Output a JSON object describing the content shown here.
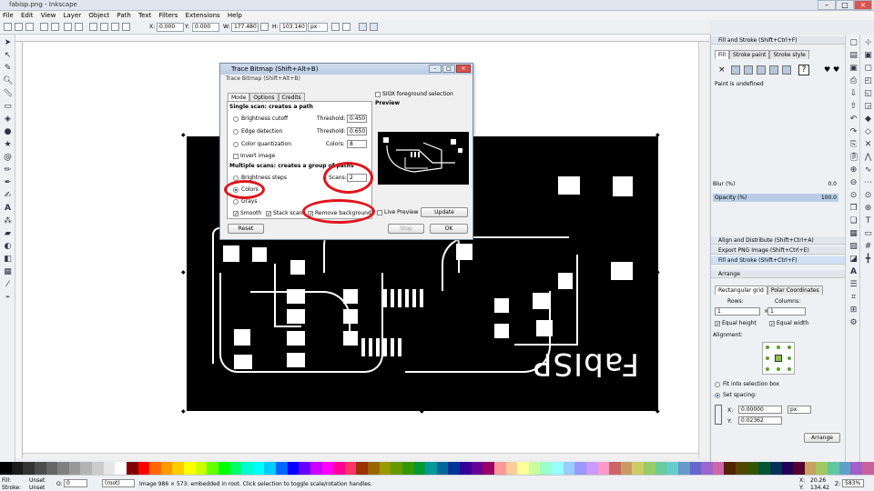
{
  "window": {
    "title": "fabisp.png - Inkscape"
  },
  "menu": [
    "File",
    "Edit",
    "View",
    "Layer",
    "Object",
    "Path",
    "Text",
    "Filters",
    "Extensions",
    "Help"
  ],
  "controls": {
    "x_label": "X:",
    "x": "0.000",
    "y_label": "Y:",
    "y": "0.000",
    "w_label": "W:",
    "w": "177.480",
    "h_label": "H:",
    "h": "103.140",
    "unit": "px"
  },
  "canvas": {
    "pcb_text": "FabISP"
  },
  "dialog": {
    "title": "Trace Bitmap (Shift+Alt+B)",
    "subtitle": "Trace Bitmap (Shift+Alt+B)",
    "tabs": [
      "Mode",
      "Options",
      "Credits"
    ],
    "single_scan": "Single scan: creates a path",
    "brightness_cutoff": "Brightness cutoff",
    "threshold_label": "Threshold:",
    "threshold1": "0.450",
    "edge_detection": "Edge detection",
    "threshold2": "0.650",
    "color_quantization": "Color quantization",
    "colors_label": "Colors:",
    "colors": "8",
    "invert_image": "Invert image",
    "multi_scan": "Multiple scans: creates a group of paths",
    "brightness_steps": "Brightness steps",
    "scans_label": "Scans:",
    "scans": "2",
    "colors_opt": "Colors",
    "grays_opt": "Grays",
    "smooth": "Smooth",
    "stack_scans": "Stack scans",
    "remove_background": "Remove background",
    "siox": "SIOX foreground selection",
    "preview_label": "Preview",
    "live_preview": "Live Preview",
    "update": "Update",
    "reset": "Reset",
    "stop": "Stop",
    "ok": "OK"
  },
  "fill_stroke": {
    "header": "Fill and Stroke (Shift+Ctrl+F)",
    "tabs": [
      "Fill",
      "Stroke paint",
      "Stroke style"
    ],
    "status": "Paint is undefined",
    "blur_label": "Blur (%)",
    "blur": "0.0",
    "opacity_label": "Opacity (%)",
    "opacity": "100.0"
  },
  "docks": [
    "Align and Distribute (Shift+Ctrl+A)",
    "Export PNG Image (Shift+Ctrl+E)",
    "Fill and Stroke (Shift+Ctrl+F)",
    "Arrange"
  ],
  "arrange": {
    "tabs": [
      "Rectangular grid",
      "Polar Coordinates"
    ],
    "rows_label": "Rows:",
    "rows": "1",
    "cols_label": "Columns:",
    "cols": "1",
    "equal_height": "Equal height",
    "equal_width": "Equal width",
    "alignment": "Alignment:",
    "fit_into": "Fit into selection box",
    "set_spacing": "Set spacing:",
    "x_label": "X:",
    "x": "0.00000",
    "y_label": "Y:",
    "y": "0.02362",
    "unit": "px",
    "arrange_btn": "Arrange"
  },
  "status": {
    "fill_label": "Fill:",
    "fill": "Unset",
    "stroke_label": "Stroke:",
    "stroke": "Unset",
    "o_label": "O:",
    "o": "0",
    "layer": "(root)",
    "message": "Image 986 × 573: embedded in root. Click selection to toggle scale/rotation handles.",
    "x_label": "X:",
    "x": "20.26",
    "y_label": "Y:",
    "y": "134.42",
    "z_label": "Z:",
    "zoom": "583%"
  },
  "palette": [
    "#000000",
    "#1a1a1a",
    "#333333",
    "#4d4d4d",
    "#666666",
    "#808080",
    "#999999",
    "#b3b3b3",
    "#cccccc",
    "#e6e6e6",
    "#ffffff",
    "#800000",
    "#ff0000",
    "#ff6600",
    "#ff9900",
    "#ffcc00",
    "#ffff00",
    "#ccff00",
    "#66ff00",
    "#00ff00",
    "#00ff66",
    "#00ffcc",
    "#00ffff",
    "#00ccff",
    "#0066ff",
    "#0000ff",
    "#6600ff",
    "#cc00ff",
    "#ff00ff",
    "#ff0099",
    "#ff3366",
    "#993300",
    "#996600",
    "#999900",
    "#669900",
    "#339900",
    "#009933",
    "#009999",
    "#006699",
    "#003399",
    "#330099",
    "#660099",
    "#990066",
    "#ff9999",
    "#ffcc99",
    "#ffff99",
    "#ccff99",
    "#99ffcc",
    "#99ffff",
    "#99ccff",
    "#9999ff",
    "#cc99ff",
    "#ff99cc",
    "#cc6666",
    "#cc9966",
    "#cccc66",
    "#99cc66",
    "#66cc99",
    "#66cccc",
    "#6699cc",
    "#6666cc",
    "#9966cc",
    "#cc66aa",
    "#552200",
    "#554400",
    "#335500",
    "#005533",
    "#003355",
    "#220055",
    "#550033",
    "#c8a060",
    "#a0c860",
    "#60c8a0",
    "#60a0c8",
    "#a060c8",
    "#c860a0"
  ]
}
